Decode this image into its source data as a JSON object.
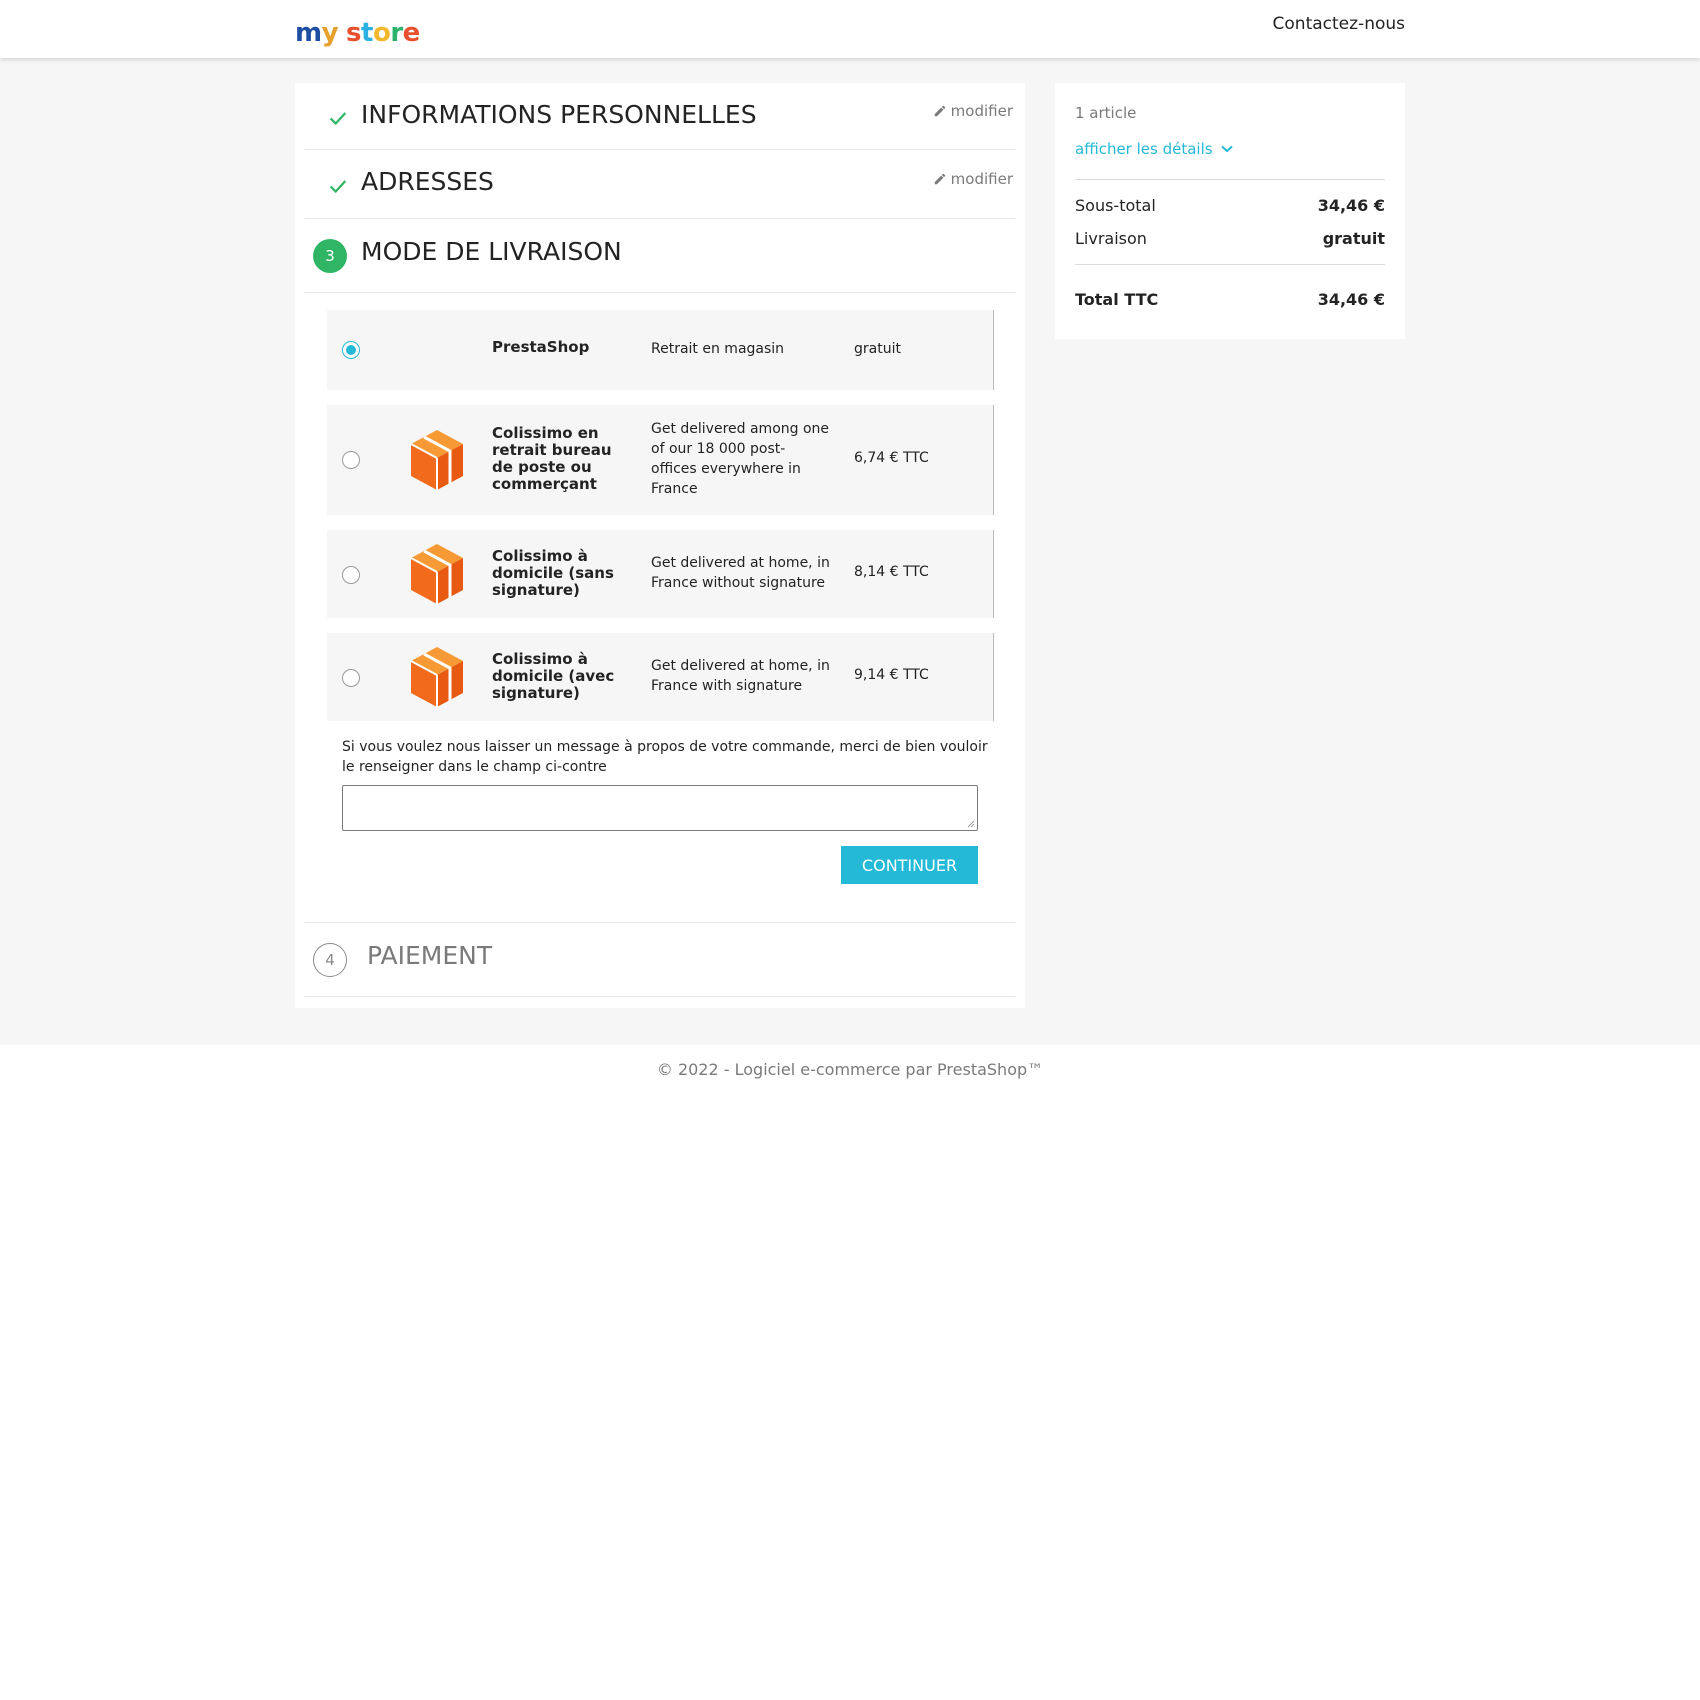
{
  "header": {
    "logo": {
      "letters": [
        {
          "ch": "m",
          "color": "#1f4fa3"
        },
        {
          "ch": "y",
          "color": "#e6a02b"
        },
        {
          "ch": "s",
          "color": "#e8502d"
        },
        {
          "ch": "t",
          "color": "#2bb0e2"
        },
        {
          "ch": "o",
          "color": "#f1b82d"
        },
        {
          "ch": "r",
          "color": "#2bb36a"
        },
        {
          "ch": "e",
          "color": "#e8502d"
        }
      ]
    },
    "contact_label": "Contactez-nous"
  },
  "checkout": {
    "steps": [
      {
        "title": "INFORMATIONS PERSONNELLES",
        "status": "done",
        "edit_label": "modifier"
      },
      {
        "title": "ADRESSES",
        "status": "done",
        "edit_label": "modifier"
      },
      {
        "number": "3",
        "title": "MODE DE LIVRAISON",
        "status": "current"
      },
      {
        "number": "4",
        "title": "PAIEMENT",
        "status": "todo"
      }
    ],
    "carriers": [
      {
        "name": "PrestaShop",
        "delay": "Retrait en magasin",
        "price": "gratuit",
        "selected": true,
        "logo": "none"
      },
      {
        "name": "Colissimo en retrait bureau de poste ou commerçant",
        "delay": "Get delivered among one of our 18 000 post-offices everywhere in France",
        "price": "6,74 € TTC",
        "selected": false,
        "logo": "package-icon"
      },
      {
        "name": "Colissimo à domicile (sans signature)",
        "delay": "Get delivered at home, in France without signature",
        "price": "8,14 € TTC",
        "selected": false,
        "logo": "package-icon"
      },
      {
        "name": "Colissimo à domicile (avec signature)",
        "delay": "Get delivered at home, in France with signature",
        "price": "9,14 € TTC",
        "selected": false,
        "logo": "package-icon"
      }
    ],
    "message_label": "Si vous voulez nous laisser un message à propos de votre commande, merci de bien vouloir le renseigner dans le champ ci-contre",
    "message_value": "",
    "continue_label": "CONTINUER"
  },
  "summary": {
    "item_count": "1 article",
    "details_label": "afficher les détails",
    "subtotal_label": "Sous-total",
    "subtotal_value": "34,46 €",
    "shipping_label": "Livraison",
    "shipping_value": "gratuit",
    "total_label": "Total TTC",
    "total_value": "34,46 €"
  },
  "footer": {
    "text": "© 2022 - Logiciel e-commerce par PrestaShop™"
  },
  "colors": {
    "accent": "#24b9d7",
    "success": "#2fb564",
    "background": "#f6f6f6"
  }
}
